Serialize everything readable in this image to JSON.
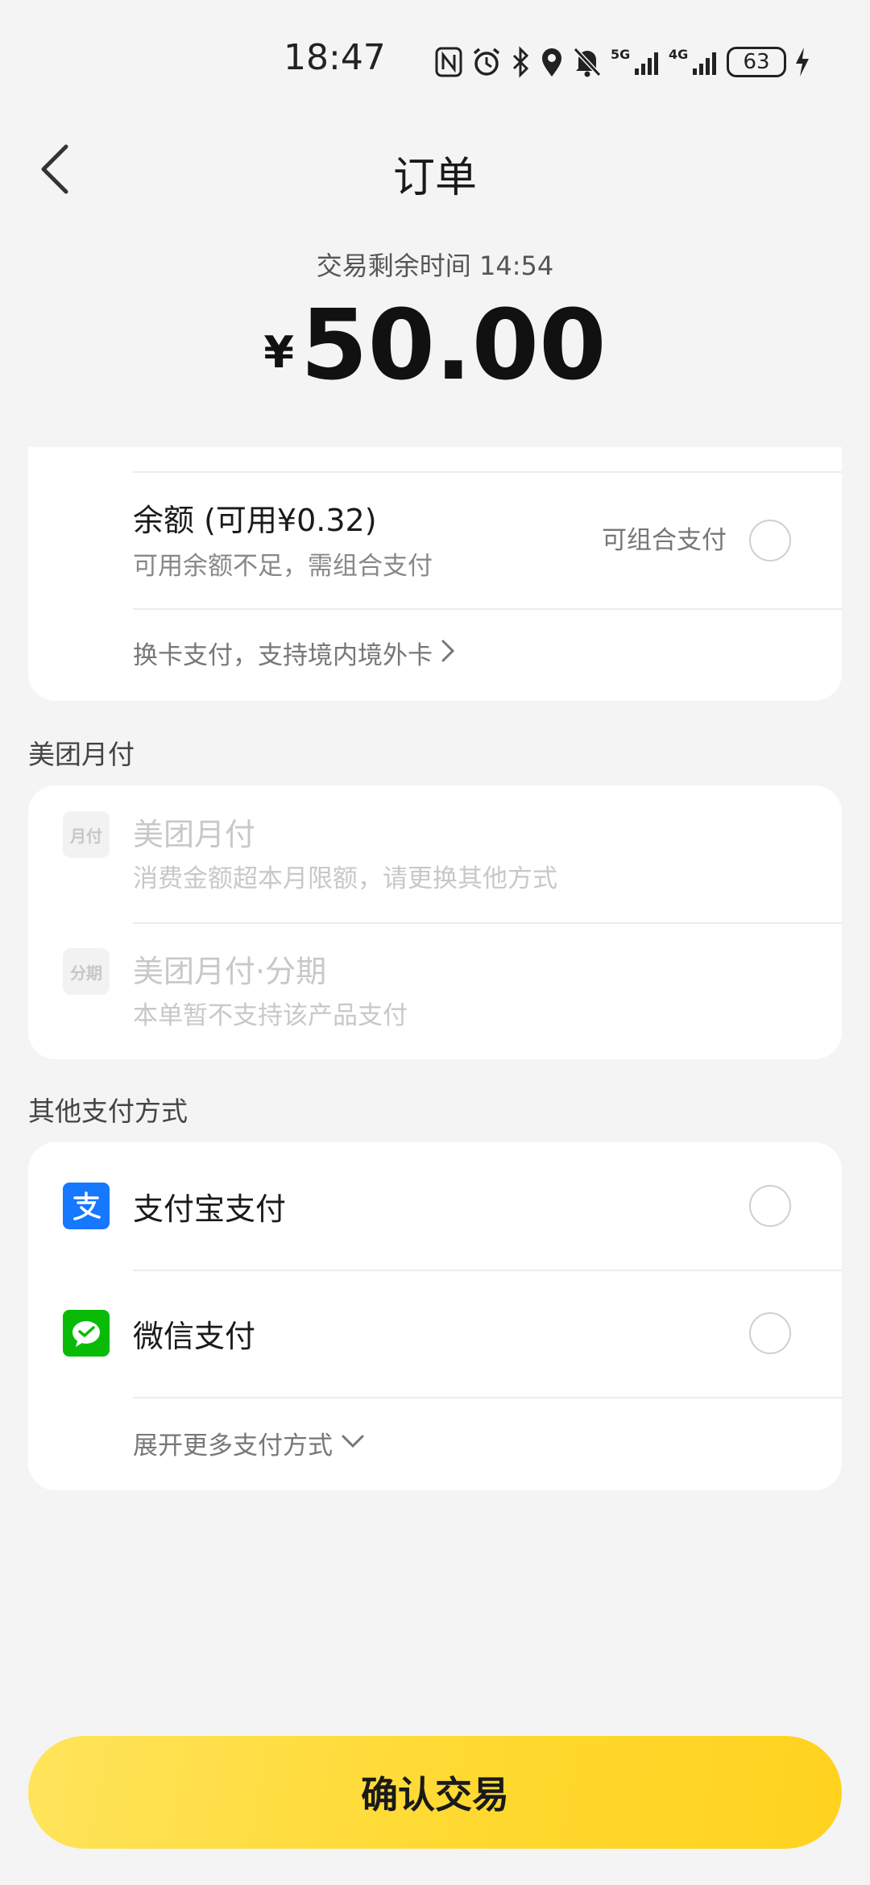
{
  "status_bar": {
    "time": "18:47",
    "battery": "63",
    "icons": [
      "nfc-icon",
      "alarm-icon",
      "bluetooth-icon",
      "location-icon",
      "mute-icon",
      "5g-signal-icon",
      "4g-signal-icon",
      "battery-icon",
      "charging-icon"
    ]
  },
  "header": {
    "title": "订单",
    "back_icon": "chevron-left-icon"
  },
  "payment": {
    "timer_text": "交易剩余时间 14:54",
    "currency": "¥",
    "amount": "50.00"
  },
  "balance_card": {
    "balance_title": "余额 (可用¥0.32)",
    "balance_subtitle": "可用余额不足，需组合支付",
    "combine_label": "可组合支付",
    "change_card_text": "换卡支付，支持境内境外卡"
  },
  "meituan_section": {
    "title": "美团月付",
    "items": [
      {
        "badge": "月付",
        "title": "美团月付",
        "subtitle": "消费金额超本月限额，请更换其他方式"
      },
      {
        "badge": "分期",
        "title": "美团月付·分期",
        "subtitle": "本单暂不支持该产品支付"
      }
    ]
  },
  "other_section": {
    "title": "其他支付方式",
    "items": [
      {
        "title": "支付宝支付",
        "icon": "alipay-icon",
        "color": "#1677ff"
      },
      {
        "title": "微信支付",
        "icon": "wechat-pay-icon",
        "color": "#09bb07"
      }
    ],
    "expand_text": "展开更多支付方式"
  },
  "confirm_button": {
    "label": "确认交易"
  },
  "colors": {
    "background": "#f4f4f4",
    "accent_yellow": "#ffd930",
    "alipay_blue": "#1677ff",
    "wechat_green": "#09bb07"
  }
}
